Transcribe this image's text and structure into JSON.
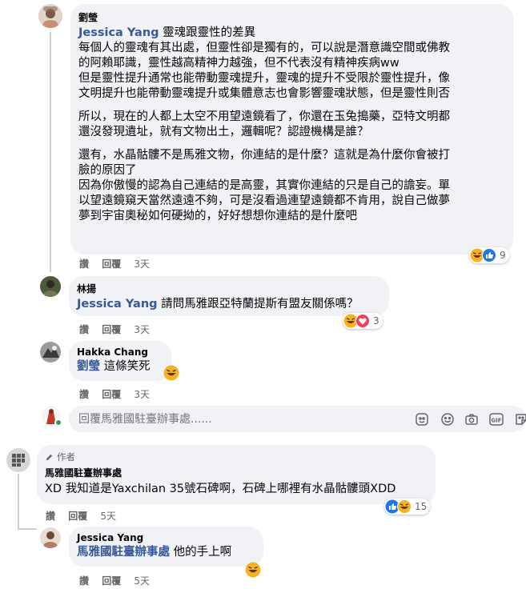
{
  "comments": [
    {
      "author": "劉瑩",
      "mention": "Jessica Yang",
      "first_line_text": " 靈魂跟靈性的差異",
      "lines": [
        "每個人的靈魂有其出處，但靈性卻是獨有的，可以說是潛意識空間或佛教",
        "的阿賴耶識，靈性越高精神力越強，但不代表沒有精神疾病ww",
        "但是靈性提升通常也能帶動靈魂提升，靈魂的提升不受限於靈性提升，像",
        "文明提升也能帶動靈魂提升或集體意志也會影響靈魂狀態，但是靈性則否",
        "所以，現在的人都上太空不用望遠鏡看了，你還在玉兔搗藥，亞特文明都",
        "還沒發現遺址，就有文物出土，邏輯呢？認證機構是誰？",
        "還有，水晶骷髏不是馬雅文物，你連結的是什麼？這就是為什麼你會被打",
        "臉的原因了",
        "因為你傲慢的認為自己連結的是高靈，其實你連結的只是自己的譫妄。單",
        "以望遠鏡窺天當然遠遠不夠，可是沒看過連望遠鏡都不肯用，說自己做夢",
        "夢到宇宙奧秘如何硬拗的，好好想想你連結的是什麼吧"
      ],
      "like_label": "讚",
      "reply_label": "回覆",
      "time": "3天",
      "reaction_count": "9"
    },
    {
      "author": "林揚",
      "mention": "Jessica Yang",
      "text": " 請問馬雅跟亞特蘭提斯有盟友關係嗎？",
      "like_label": "讚",
      "reply_label": "回覆",
      "time": "3天",
      "reaction_count": "3"
    },
    {
      "author": "Hakka Chang",
      "mention": "劉瑩",
      "text": " 這條笑死",
      "like_label": "讚",
      "reply_label": "回覆",
      "time": "3天"
    },
    {
      "author_badge": "作者",
      "author": "馬雅國駐臺辦事處",
      "text": "XD 我知道是Yaxchilan 35號石碑啊，石碑上哪裡有水晶骷髏頭XDD",
      "like_label": "讚",
      "reply_label": "回覆",
      "time": "5天",
      "reaction_count": "15"
    },
    {
      "author": "Jessica Yang",
      "mention": "馬雅國駐臺辦事處",
      "text": " 他的手上啊",
      "like_label": "讚",
      "reply_label": "回覆",
      "time": "5天"
    }
  ],
  "reply_box": {
    "placeholder": "回覆馬雅國駐臺辦事處......"
  },
  "colors": {
    "bubble": "#f0f2f5",
    "like_blue": "#1877f2",
    "love_red": "#f33e58",
    "haha_yellow": "#f7b125",
    "mention": "#385898",
    "online_green": "#31a24c"
  },
  "icons": [
    "emoji-icon",
    "sticker-icon",
    "camera-icon",
    "gif-icon",
    "sticker-square-icon",
    "pencil-icon"
  ]
}
